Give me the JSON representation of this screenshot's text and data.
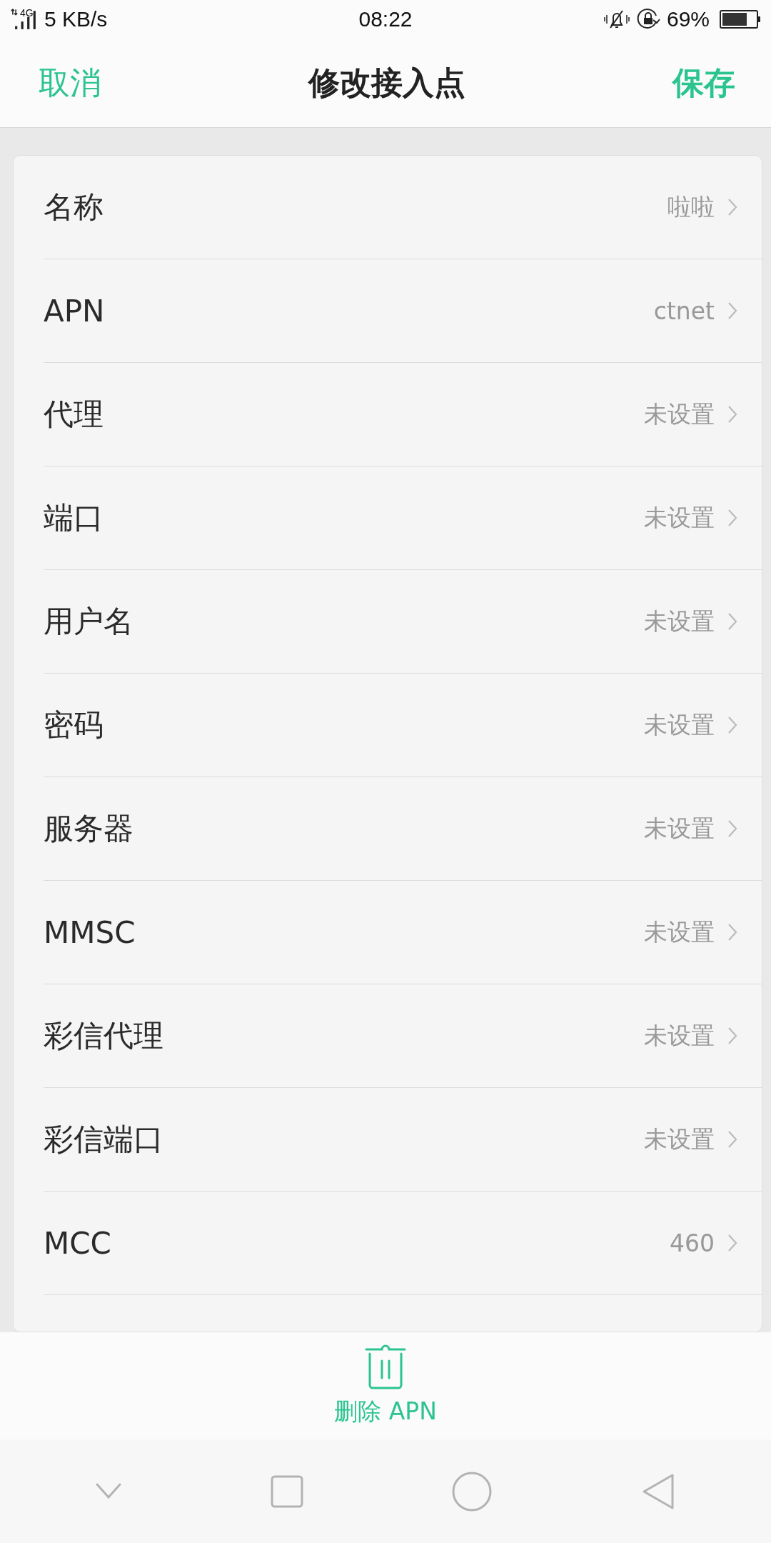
{
  "status_bar": {
    "network": "4G",
    "speed": "5 KB/s",
    "time": "08:22",
    "battery": "69%"
  },
  "header": {
    "cancel": "取消",
    "title": "修改接入点",
    "save": "保存"
  },
  "rows": [
    {
      "label": "名称",
      "value": "啦啦"
    },
    {
      "label": "APN",
      "value": "ctnet"
    },
    {
      "label": "代理",
      "value": "未设置"
    },
    {
      "label": "端口",
      "value": "未设置"
    },
    {
      "label": "用户名",
      "value": "未设置"
    },
    {
      "label": "密码",
      "value": "未设置"
    },
    {
      "label": "服务器",
      "value": "未设置"
    },
    {
      "label": "MMSC",
      "value": "未设置"
    },
    {
      "label": "彩信代理",
      "value": "未设置"
    },
    {
      "label": "彩信端口",
      "value": "未设置"
    },
    {
      "label": "MCC",
      "value": "460"
    }
  ],
  "delete_button": {
    "label": "删除 APN"
  }
}
